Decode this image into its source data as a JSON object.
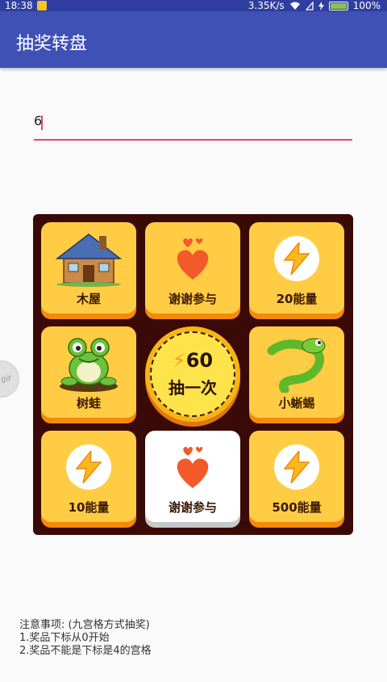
{
  "status_bar": {
    "time": "18:38",
    "network_speed": "3.35K/s",
    "battery": "100%",
    "battery_level": 1.0
  },
  "app_bar": {
    "title": "抽奖转盘"
  },
  "input": {
    "value": "6"
  },
  "gif_tab": {
    "label": "gif"
  },
  "board": {
    "cells": [
      {
        "label": "木屋",
        "icon": "cabin-icon"
      },
      {
        "label": "谢谢参与",
        "icon": "hearts-icon"
      },
      {
        "label": "20能量",
        "icon": "lightning-icon"
      },
      {
        "label": "小蜥蜴",
        "icon": "lizard-icon"
      },
      {
        "label": "500能量",
        "icon": "lightning-icon"
      },
      {
        "label": "谢谢参与",
        "icon": "hearts-icon"
      },
      {
        "label": "10能量",
        "icon": "lightning-icon"
      },
      {
        "label": "树蛙",
        "icon": "frog-icon"
      }
    ],
    "active_index": 5,
    "center": {
      "count": "60",
      "action": "抽一次"
    }
  },
  "notes": {
    "title": "注意事项: (九宫格方式抽奖)",
    "line1": "1.奖品下标从0开始",
    "line2": "2.奖品不能是下标是4的宫格"
  },
  "colors": {
    "primary": "#3f51b5",
    "primary_dark": "#303f9f",
    "accent": "#ec407a",
    "board_bg": "#3a0a06",
    "cell_bg": "#ffcc44",
    "cell_shadow": "#f28a0d",
    "active_cell_bg": "#ffffff"
  }
}
